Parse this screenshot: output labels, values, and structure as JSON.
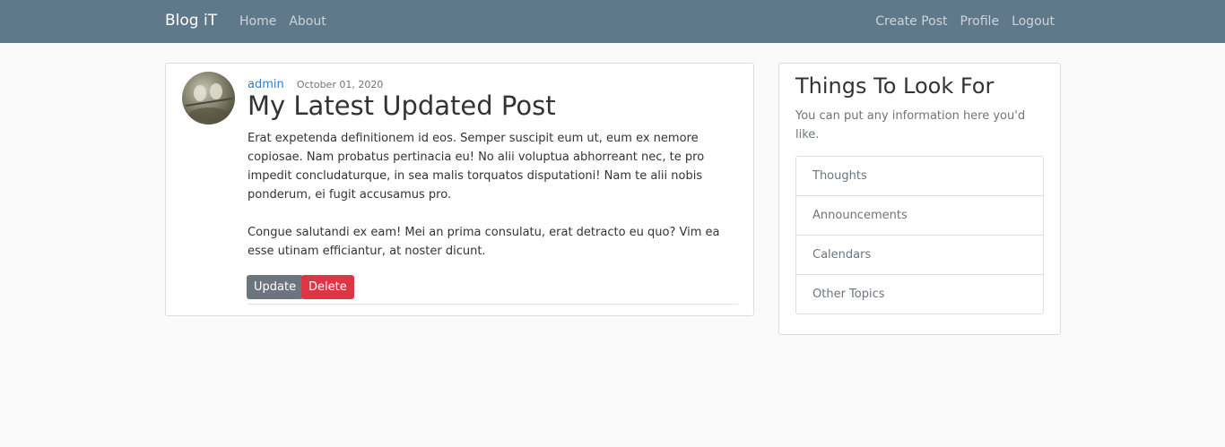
{
  "navbar": {
    "brand": "Blog iT",
    "left_links": [
      "Home",
      "About"
    ],
    "right_links": [
      "Create Post",
      "Profile",
      "Logout"
    ],
    "background": "#5f788a"
  },
  "post": {
    "author": "admin",
    "date": "October 01, 2020",
    "title": "My Latest Updated Post",
    "paragraphs": [
      "Erat expetenda definitionem id eos. Semper suscipit eum ut, eum ex nemore copiosae. Nam probatus pertinacia eu! No alii voluptua abhorreant nec, te pro impedit concludaturque, in sea malis torquatos disputationi! Nam te alii nobis ponderum, ei fugit accusamus pro.",
      "Congue salutandi ex eam! Mei an prima consulatu, erat detracto eu quo? Vim ea esse utinam efficiantur, at noster dicunt."
    ],
    "update_label": "Update",
    "delete_label": "Delete",
    "avatar_icon": "avatar-photo-birds"
  },
  "sidebar": {
    "title": "Things To Look For",
    "text": "You can put any information here you'd like.",
    "items": [
      "Thoughts",
      "Announcements",
      "Calendars",
      "Other Topics"
    ]
  },
  "colors": {
    "link": "#2a7fd0",
    "update_button": "#6c757d",
    "delete_button": "#dc3545"
  }
}
